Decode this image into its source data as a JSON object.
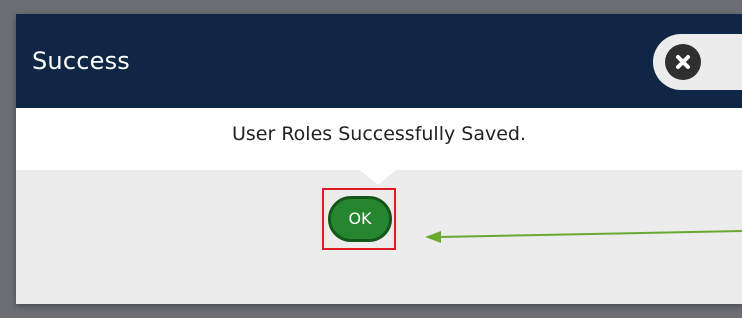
{
  "dialog": {
    "title": "Success",
    "message": "User Roles Successfully Saved.",
    "ok_label": "OK",
    "close_icon": "close-icon"
  },
  "annotations": {
    "highlight_color": "#e01b24",
    "arrow_color": "#6aa832"
  },
  "colors": {
    "header_background": "#0f2745",
    "button_background": "#25862f",
    "backdrop": "#6b6f74"
  }
}
